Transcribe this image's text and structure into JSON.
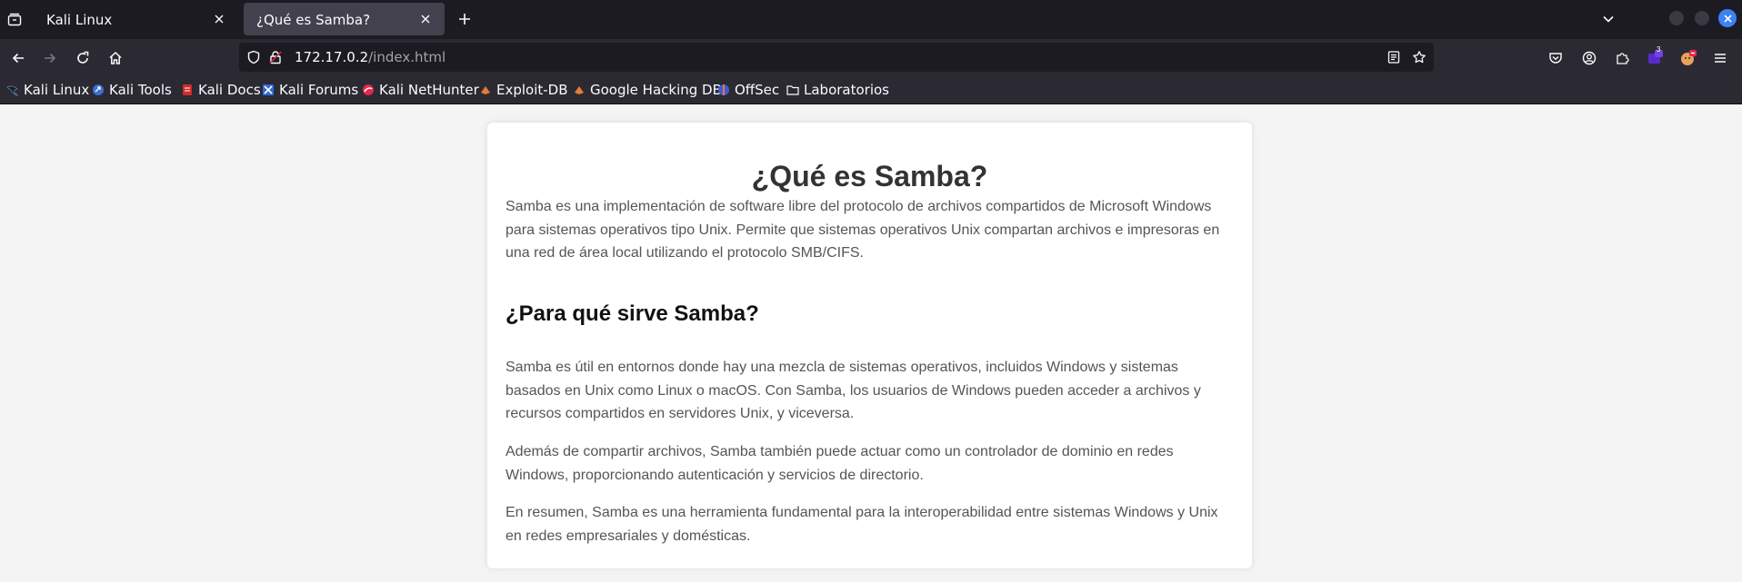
{
  "browser": {
    "tabs": [
      {
        "title": "Kali Linux",
        "active": false
      },
      {
        "title": "¿Qué es Samba?",
        "active": true
      }
    ],
    "url": {
      "host": "172.17.0.2",
      "path": "/index.html"
    },
    "extension_badge": "3",
    "bookmarks": [
      {
        "label": "Kali Linux",
        "icon": "kali-dragon-icon"
      },
      {
        "label": "Kali Tools",
        "icon": "kali-tools-icon"
      },
      {
        "label": "Kali Docs",
        "icon": "kali-docs-icon"
      },
      {
        "label": "Kali Forums",
        "icon": "kali-forums-icon"
      },
      {
        "label": "Kali NetHunter",
        "icon": "kali-nethunter-icon"
      },
      {
        "label": "Exploit-DB",
        "icon": "exploit-db-icon"
      },
      {
        "label": "Google Hacking DB",
        "icon": "ghdb-icon"
      },
      {
        "label": "OffSec",
        "icon": "offsec-icon"
      },
      {
        "label": "Laboratorios",
        "icon": "folder-icon"
      }
    ]
  },
  "page": {
    "title": "¿Qué es Samba?",
    "intro": "Samba es una implementación de software libre del protocolo de archivos compartidos de Microsoft Windows para sistemas operativos tipo Unix. Permite que sistemas operativos Unix compartan archivos e impresoras en una red de área local utilizando el protocolo SMB/CIFS.",
    "subtitle": "¿Para qué sirve Samba?",
    "paragraphs": [
      "Samba es útil en entornos donde hay una mezcla de sistemas operativos, incluidos Windows y sistemas basados en Unix como Linux o macOS. Con Samba, los usuarios de Windows pueden acceder a archivos y recursos compartidos en servidores Unix, y viceversa.",
      "Además de compartir archivos, Samba también puede actuar como un controlador de dominio en redes Windows, proporcionando autenticación y servicios de directorio.",
      "En resumen, Samba es una herramienta fundamental para la interoperabilidad entre sistemas Windows y Unix en redes empresariales y domésticas."
    ]
  },
  "colors": {
    "tabbar_bg": "#1c1b22",
    "toolbar_bg": "#2b2a33",
    "page_bg": "#f4f4f4",
    "card_bg": "#ffffff",
    "heading": "#333333",
    "text": "#555555",
    "accent_blue": "#3d82f5"
  }
}
